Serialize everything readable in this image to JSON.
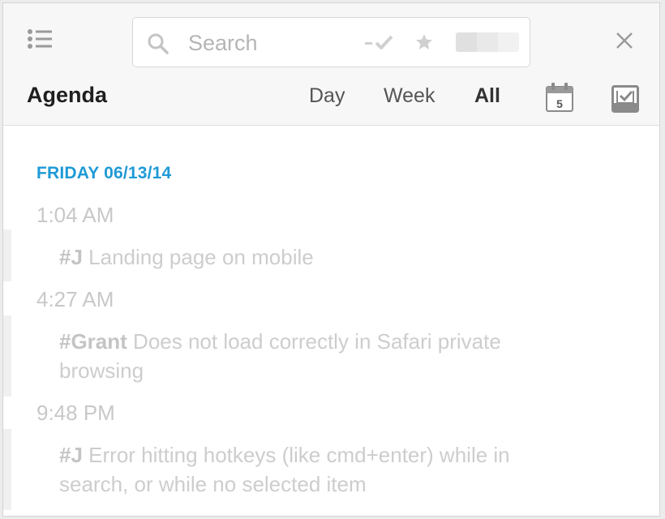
{
  "header": {
    "search": {
      "placeholder": "Search",
      "value": ""
    },
    "filters": {
      "check_icon": "dash-check-icon",
      "star_icon": "star-icon",
      "toggle_colors": [
        "#e0e0e0",
        "#e9e9e9",
        "#f1f1f1"
      ]
    },
    "close_icon": "close-icon",
    "list_icon": "list-icon"
  },
  "toolbar": {
    "title": "Agenda",
    "tabs": [
      {
        "label": "Day",
        "active": false
      },
      {
        "label": "Week",
        "active": false
      },
      {
        "label": "All",
        "active": true
      }
    ],
    "calendar_icon_day": "5"
  },
  "agenda": {
    "date": "FRIDAY 06/13/14",
    "entries": [
      {
        "time": "1:04 AM",
        "tag": "#J",
        "text": "Landing page on mobile"
      },
      {
        "time": "4:27 AM",
        "tag": "#Grant",
        "text": "Does not load correctly in Safari private browsing"
      },
      {
        "time": "9:48 PM",
        "tag": "#J",
        "text": "Error hitting hotkeys (like cmd+enter) while in search, or while no selected item"
      }
    ]
  },
  "colors": {
    "accent": "#1e9ad6",
    "muted_text": "#cdcdcd",
    "title_text": "#1f1f1f"
  }
}
